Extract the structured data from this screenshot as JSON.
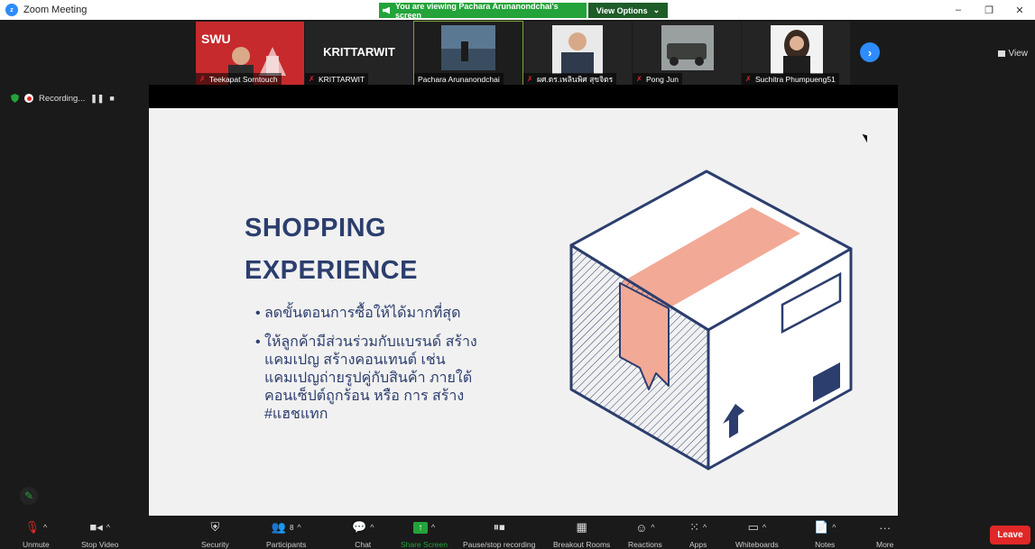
{
  "window": {
    "title": "Zoom Meeting"
  },
  "banner": {
    "viewing_text": "You are viewing Pachara Arunanondchai's screen",
    "view_options": "View Options"
  },
  "gallery": {
    "participants": [
      {
        "name": "Teekapat Sorntouch",
        "muted": true
      },
      {
        "name": "KRITTARWIT",
        "muted": true,
        "display_text": "KRITTARWIT"
      },
      {
        "name": "Pachara Arunanondchai",
        "muted": false
      },
      {
        "name": "ผศ.ดร.เพลินพิศ สุขจิตร",
        "muted": true
      },
      {
        "name": "Pong Jun",
        "muted": true
      },
      {
        "name": "Suchitra Phumpueng51",
        "muted": true
      }
    ],
    "view_label": "View"
  },
  "recording": {
    "label": "Recording..."
  },
  "slide": {
    "title_line1": "SHOPPING",
    "title_line2": "EXPERIENCE",
    "bullets": [
      "ลดขั้นตอนการซื้อให้ได้มากที่สุด",
      "ให้ลูกค้ามีส่วนร่วมกับแบรนด์ สร้างแคมเปญ สร้างคอนเทนต์ เช่น แคมเปญถ่ายรูปคู่กับสินค้า ภายใต้คอนเซ็ปต์ถูกร้อน หรือ การ สร้าง #แฮชแทก"
    ],
    "box_colors": {
      "outline": "#2c3e6e",
      "tape": "#f2a996",
      "fill": "#ffffff"
    }
  },
  "toolbar": {
    "unmute": "Unmute",
    "stop_video": "Stop Video",
    "security": "Security",
    "participants": "Participants",
    "participants_count": "8",
    "chat": "Chat",
    "share_screen": "Share Screen",
    "pause_recording": "Pause/stop recording",
    "breakout_rooms": "Breakout Rooms",
    "reactions": "Reactions",
    "apps": "Apps",
    "whiteboards": "Whiteboards",
    "notes": "Notes",
    "more": "More",
    "leave": "Leave"
  }
}
